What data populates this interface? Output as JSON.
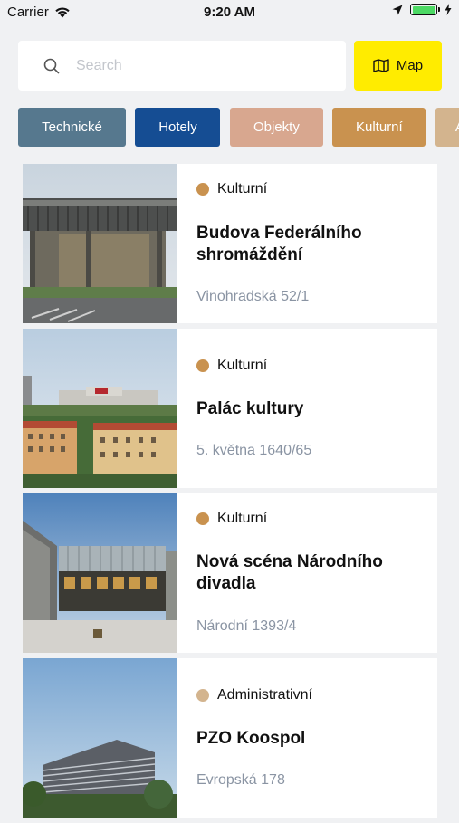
{
  "status_bar": {
    "carrier": "Carrier",
    "time": "9:20 AM"
  },
  "search": {
    "placeholder": "Search",
    "value": ""
  },
  "map_button": {
    "label": "Map"
  },
  "categories": [
    {
      "label": "Technické",
      "color": "#56788e"
    },
    {
      "label": "Hotely",
      "color": "#154d93"
    },
    {
      "label": "Objekty",
      "color": "#d8a78f"
    },
    {
      "label": "Kulturní",
      "color": "#c9924f"
    },
    {
      "label": "Ad",
      "color": "#d3b48e"
    }
  ],
  "places": [
    {
      "category": "Kulturní",
      "category_color": "#c9924f",
      "title": "Budova Federálního shromáždění",
      "address": "Vinohradská 52/1",
      "image": "federal-assembly-building-photo"
    },
    {
      "category": "Kulturní",
      "category_color": "#c9924f",
      "title": "Palác kultury",
      "address": "5. května 1640/65",
      "image": "palace-of-culture-photo"
    },
    {
      "category": "Kulturní",
      "category_color": "#c9924f",
      "title": "Nová scéna Národního divadla",
      "address": "Národní 1393/4",
      "image": "new-stage-national-theatre-photo"
    },
    {
      "category": "Administrativní",
      "category_color": "#d3b48e",
      "title": "PZO Koospol",
      "address": "Evropská 178",
      "image": "pzo-koospol-photo"
    }
  ]
}
